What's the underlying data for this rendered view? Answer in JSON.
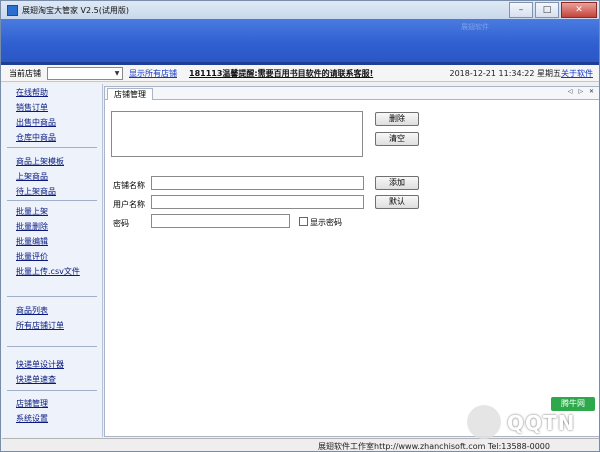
{
  "window": {
    "title": "展翅淘宝大管家 V2.5(试用版)"
  },
  "banner": {
    "watermark": "展翅软件"
  },
  "infobar": {
    "store_label": "当前店铺",
    "store_value": "",
    "show_all_link": "显示所有店铺",
    "announcement": "181113温馨提醒:需要百用书目软件的请联系客服!",
    "datetime": "2018-12-21  11:34:22  星期五",
    "about_link": "关于软件"
  },
  "sidebar": {
    "items": [
      "在线帮助",
      "销售订单",
      "出售中商品",
      "仓库中商品",
      "商品上架模板",
      "上架商品",
      "待上架商品",
      "批量上架",
      "批量删除",
      "批量编辑",
      "批量评价",
      "批量上传.csv文件",
      "商品列表",
      "所有店铺订单",
      "快递单设计器",
      "快递单速查",
      "店铺管理",
      "系统设置"
    ]
  },
  "tabs": {
    "active": "店铺管理",
    "controls": "◁ ▷ ✕"
  },
  "form": {
    "delete_button": "删除",
    "clear_button": "清空",
    "store_name_label": "店铺名称",
    "username_label": "用户名称",
    "password_label": "密码",
    "add_button": "添加",
    "default_button": "默认",
    "show_password_label": "显示密码"
  },
  "statusbar": {
    "text": "展翅软件工作室http://www.zhanchisoft.com  Tel:13588-0000"
  },
  "watermark_logo": {
    "text": "QQTN",
    "sub": "腾牛网"
  },
  "colors": {
    "banner": "#2f5fd0",
    "link": "#1437c7",
    "sidebar_bg": "#eef3fb"
  }
}
